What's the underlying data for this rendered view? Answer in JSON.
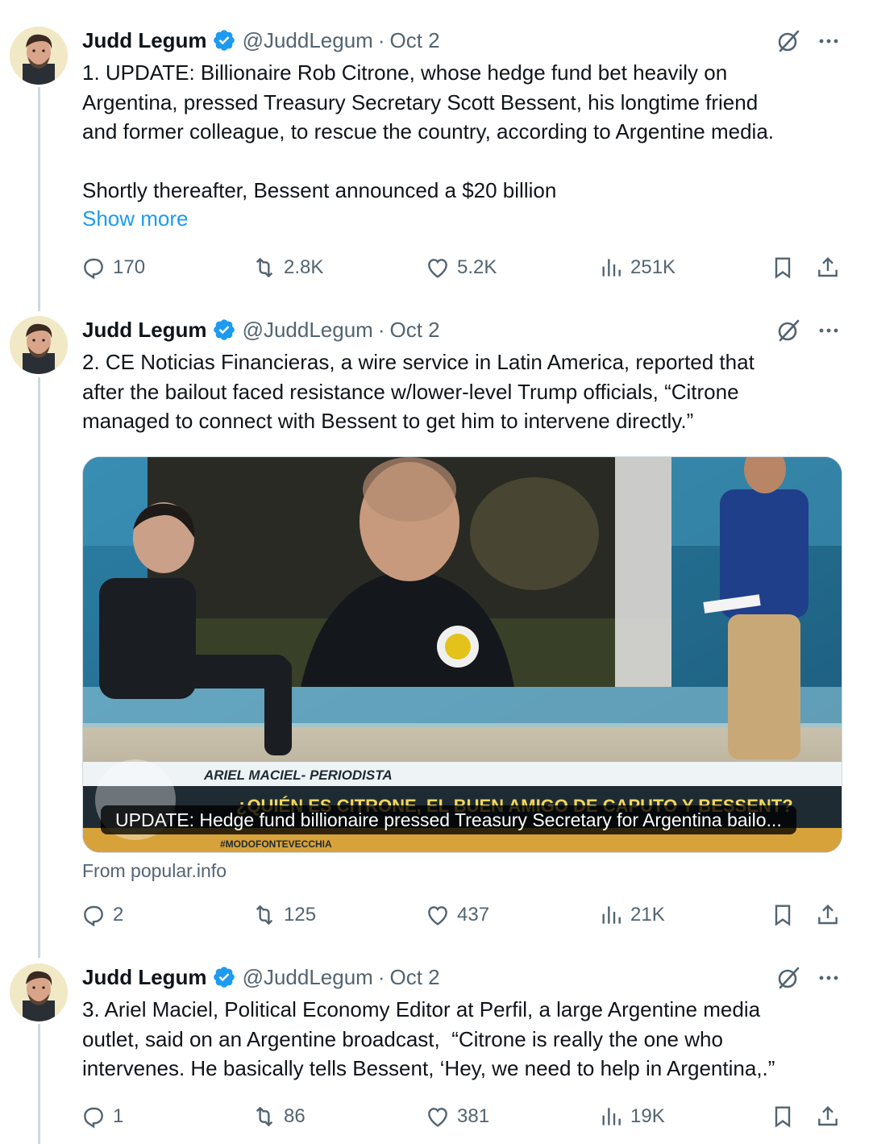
{
  "author": {
    "name": "Judd Legum",
    "handle": "@JuddLegum",
    "separator": "·"
  },
  "colors": {
    "verified": "#1d9bf0",
    "link": "#1d9bf0",
    "muted": "#536471",
    "text": "#0f1419"
  },
  "icons": {
    "reply": "reply-icon",
    "retweet": "retweet-icon",
    "like": "heart-icon",
    "views": "views-icon",
    "bookmark": "bookmark-icon",
    "share": "share-icon",
    "grok": "grok-icon",
    "more": "more-icon"
  },
  "tweets": [
    {
      "date": "Oct 2",
      "lines": [
        "1. UPDATE: Billionaire Rob Citrone, whose hedge fund bet heavily on",
        "Argentina, pressed Treasury Secretary Scott Bessent, his longtime friend",
        "and former colleague, to rescue the country, according to Argentine media.",
        "",
        "Shortly thereafter, Bessent announced a $20 billion"
      ],
      "show_more": "Show more",
      "replies": "170",
      "retweets": "2.8K",
      "likes": "5.2K",
      "views": "251K"
    },
    {
      "date": "Oct 2",
      "lines": [
        "2. CE Noticias Financieras, a wire service in Latin America, reported that",
        "after the bailout faced resistance w/lower-level Trump officials, “Citrone",
        "managed to connect with Bessent to get him to intervene directly.”"
      ],
      "card": {
        "caption": "UPDATE: Hedge fund billionaire pressed Treasury Secretary for Argentina bailo...",
        "source": "From popular.info",
        "lower_third_name": "ARIEL MACIEL- PERIODISTA",
        "lower_third_headline": "¿QUIÉN ES CITRONE, EL BUEN AMIGO DE CAPUTO Y BESSENT?",
        "hashtag": "#MODOFONTEVECCHIA"
      },
      "replies": "2",
      "retweets": "125",
      "likes": "437",
      "views": "21K"
    },
    {
      "date": "Oct 2",
      "lines": [
        "3. Ariel Maciel, Political Economy Editor at Perfil, a large Argentine media",
        "outlet, said on an Argentine broadcast,  “Citrone is really the one who",
        "intervenes. He basically tells Bessent, ‘Hey, we need to help in Argentina,.”"
      ],
      "replies": "1",
      "retweets": "86",
      "likes": "381",
      "views": "19K"
    }
  ]
}
